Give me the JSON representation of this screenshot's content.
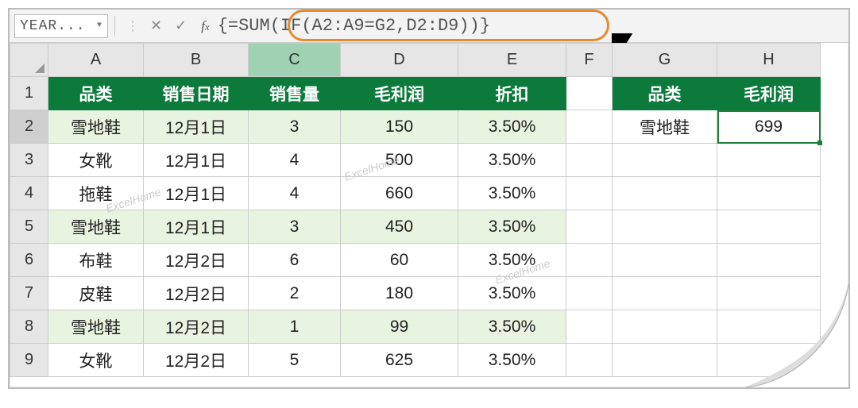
{
  "name_box": "YEAR...",
  "formula": "{=SUM(IF(A2:A9=G2,D2:D9))}",
  "watermark": "ExcelHome",
  "columns": [
    "A",
    "B",
    "C",
    "D",
    "E",
    "F",
    "G",
    "H"
  ],
  "rows": [
    "1",
    "2",
    "3",
    "4",
    "5",
    "6",
    "7",
    "8",
    "9"
  ],
  "active_col": "C",
  "headers_main": {
    "A": "品类",
    "B": "销售日期",
    "C": "销售量",
    "D": "毛利润",
    "E": "折扣"
  },
  "headers_side": {
    "G": "品类",
    "H": "毛利润"
  },
  "data": [
    {
      "A": "雪地鞋",
      "B": "12月1日",
      "C": "3",
      "D": "150",
      "E": "3.50%",
      "alt": true
    },
    {
      "A": "女靴",
      "B": "12月1日",
      "C": "4",
      "D": "500",
      "E": "3.50%",
      "alt": false
    },
    {
      "A": "拖鞋",
      "B": "12月1日",
      "C": "4",
      "D": "660",
      "E": "3.50%",
      "alt": false
    },
    {
      "A": "雪地鞋",
      "B": "12月1日",
      "C": "3",
      "D": "450",
      "E": "3.50%",
      "alt": true
    },
    {
      "A": "布鞋",
      "B": "12月2日",
      "C": "6",
      "D": "60",
      "E": "3.50%",
      "alt": false
    },
    {
      "A": "皮鞋",
      "B": "12月2日",
      "C": "2",
      "D": "180",
      "E": "3.50%",
      "alt": false
    },
    {
      "A": "雪地鞋",
      "B": "12月2日",
      "C": "1",
      "D": "99",
      "E": "3.50%",
      "alt": true
    },
    {
      "A": "女靴",
      "B": "12月2日",
      "C": "5",
      "D": "625",
      "E": "3.50%",
      "alt": false
    }
  ],
  "side": {
    "G": "雪地鞋",
    "H": "699"
  }
}
